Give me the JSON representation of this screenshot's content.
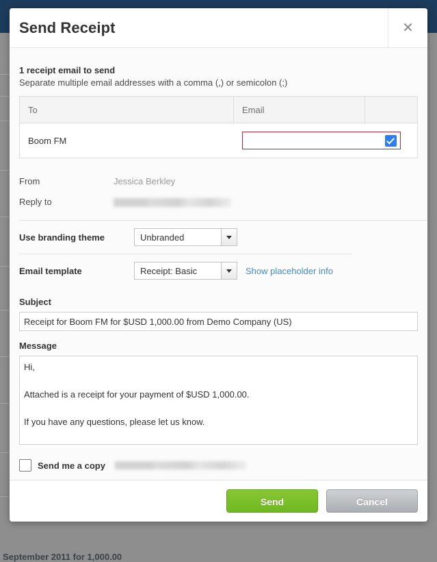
{
  "modal": {
    "title": "Send Receipt",
    "close_icon": "close-icon",
    "lead_strong": "1 receipt email to send",
    "lead_sub": "Separate multiple email addresses with a comma (,) or semicolon (;)"
  },
  "recipients": {
    "columns": [
      "To",
      "Email",
      ""
    ],
    "rows": [
      {
        "to": "Boom FM",
        "email": "",
        "email_placeholder": "",
        "selected": true
      }
    ]
  },
  "meta": {
    "from_label": "From",
    "from_value": "Jessica Berkley",
    "reply_to_label": "Reply to",
    "reply_to_value": ""
  },
  "branding": {
    "label": "Use branding theme",
    "selected": "Unbranded",
    "options": [
      "Unbranded"
    ]
  },
  "template": {
    "label": "Email template",
    "selected": "Receipt: Basic",
    "options": [
      "Receipt: Basic"
    ],
    "placeholder_link": "Show placeholder info"
  },
  "subject": {
    "label": "Subject",
    "value": "Receipt for Boom FM for $USD 1,000.00 from Demo Company (US)"
  },
  "message": {
    "label": "Message",
    "value": "Hi,\n\nAttached is a receipt for your payment of $USD 1,000.00.\n\nIf you have any questions, please let us know.\n\nThanks,\nDemo Company (US)"
  },
  "send_copy": {
    "label": "Send me a copy",
    "email": "",
    "checked": false
  },
  "footer": {
    "send_label": "Send",
    "cancel_label": "Cancel"
  },
  "backdrop": {
    "bottom_text": "September 2011 for 1,000.00"
  },
  "colors": {
    "accent_green": "#76be25",
    "cancel_gray": "#b8bcc0",
    "link_blue": "#3b8ed0",
    "error_red": "#b3253a",
    "checkbox_blue": "#2d7ff0",
    "topbar_navy": "#1c3c5c"
  }
}
